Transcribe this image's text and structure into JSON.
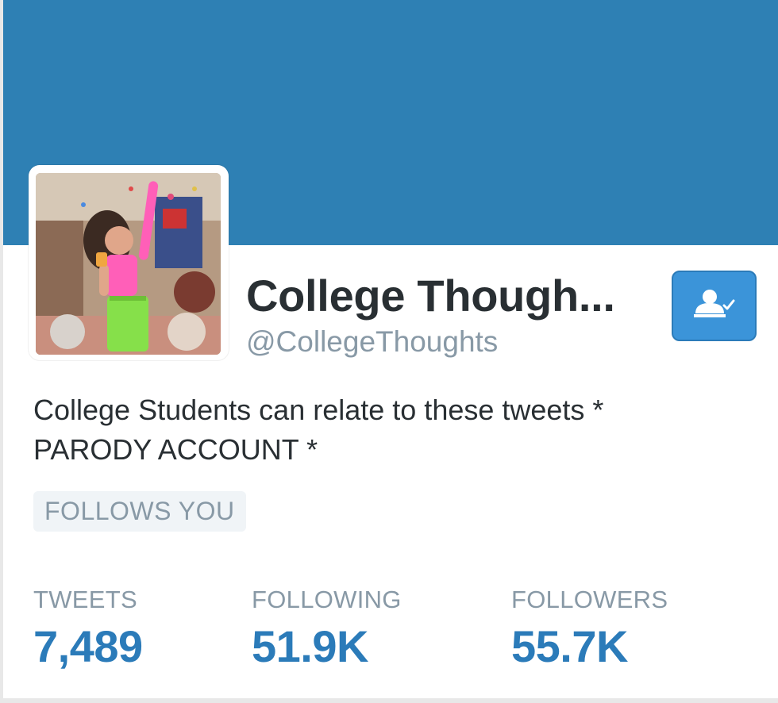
{
  "profile": {
    "name": "College Though...",
    "handle": "@CollegeThoughts",
    "bio_line1": "College Students can relate to these tweets *",
    "bio_line2": "PARODY ACCOUNT *",
    "follows_you": "FOLLOWS YOU",
    "banner_color": "#2e80b4",
    "follow_button_icon": "user-following-icon"
  },
  "stats": [
    {
      "label": "TWEETS",
      "value": "7,489"
    },
    {
      "label": "FOLLOWING",
      "value": "51.9K"
    },
    {
      "label": "FOLLOWERS",
      "value": "55.7K"
    }
  ]
}
